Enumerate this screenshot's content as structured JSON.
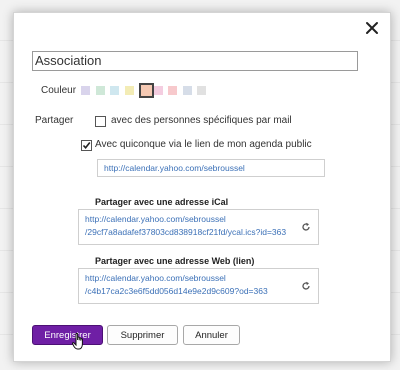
{
  "dialog": {
    "name_value": "Association",
    "color_label": "Couleur",
    "colors": [
      {
        "hex": "#d9d4ec"
      },
      {
        "hex": "#cfe8d8"
      },
      {
        "hex": "#cfe7ef"
      },
      {
        "hex": "#f3ecb5"
      },
      {
        "hex": "#f5c9b3",
        "selected": true
      },
      {
        "hex": "#f4cde0"
      },
      {
        "hex": "#f7c9cc"
      },
      {
        "hex": "#d6dde8"
      },
      {
        "hex": "#e1e1e1"
      }
    ],
    "share_label": "Partager",
    "option_specific": {
      "label": "avec des personnes spécifiques par mail",
      "checked": false
    },
    "option_public": {
      "label": "Avec quiconque via le lien de mon agenda public",
      "checked": true
    },
    "public_url": "http://calendar.yahoo.com/sebroussel",
    "ical_title": "Partager avec une adresse iCal",
    "ical_url_line1": "http://calendar.yahoo.com/sebroussel",
    "ical_url_line2": "/29cf7a8adafef37803cd838918cf21fd/ycal.ics?id=363",
    "web_title": "Partager avec une adresse Web (lien)",
    "web_url_line1": "http://calendar.yahoo.com/sebroussel",
    "web_url_line2": "/c4b17ca2c3e6f5dd056d14e9e2d9c609?od=363",
    "buttons": {
      "save": "Enregistrer",
      "delete": "Supprimer",
      "cancel": "Annuler"
    },
    "accent": "#6f1fa5",
    "link_color": "#3b70b7"
  }
}
